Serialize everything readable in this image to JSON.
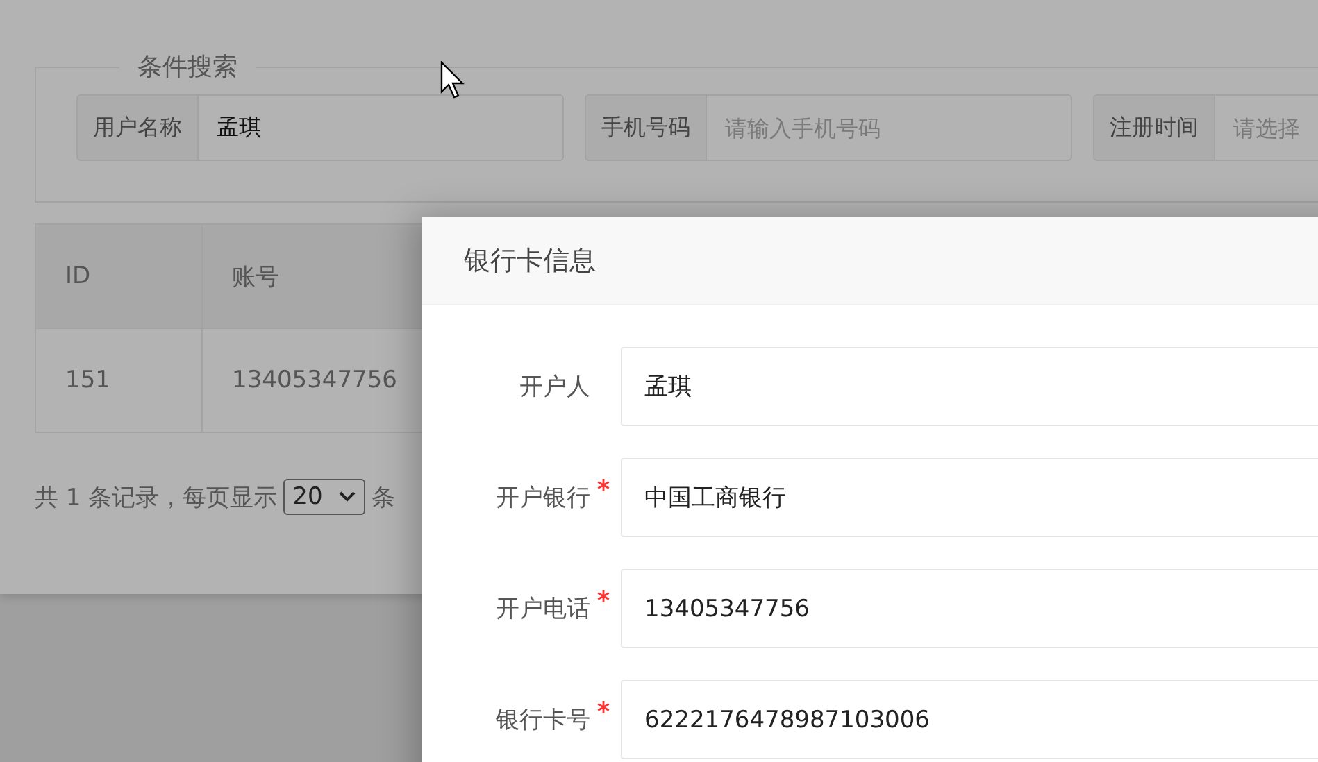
{
  "search": {
    "legend": "条件搜索",
    "fields": [
      {
        "label": "用户名称",
        "value": "孟琪"
      },
      {
        "label": "手机号码",
        "placeholder": "请输入手机号码"
      },
      {
        "label": "注册时间",
        "placeholder": "请选择"
      }
    ]
  },
  "table": {
    "columns": [
      "ID",
      "账号"
    ],
    "rows": [
      [
        "151",
        "13405347756"
      ]
    ]
  },
  "pagination": {
    "summary": "共 1 条记录，每页显示",
    "page_size": "20",
    "unit": "条"
  },
  "dialog": {
    "title": "银行卡信息",
    "fields": [
      {
        "label": "开户人",
        "value": "孟琪",
        "required": false
      },
      {
        "label": "开户银行",
        "value": "中国工商银行",
        "required": true
      },
      {
        "label": "开户电话",
        "value": "13405347756",
        "required": true
      },
      {
        "label": "银行卡号",
        "value": "6222176478987103006",
        "required": true
      }
    ]
  }
}
